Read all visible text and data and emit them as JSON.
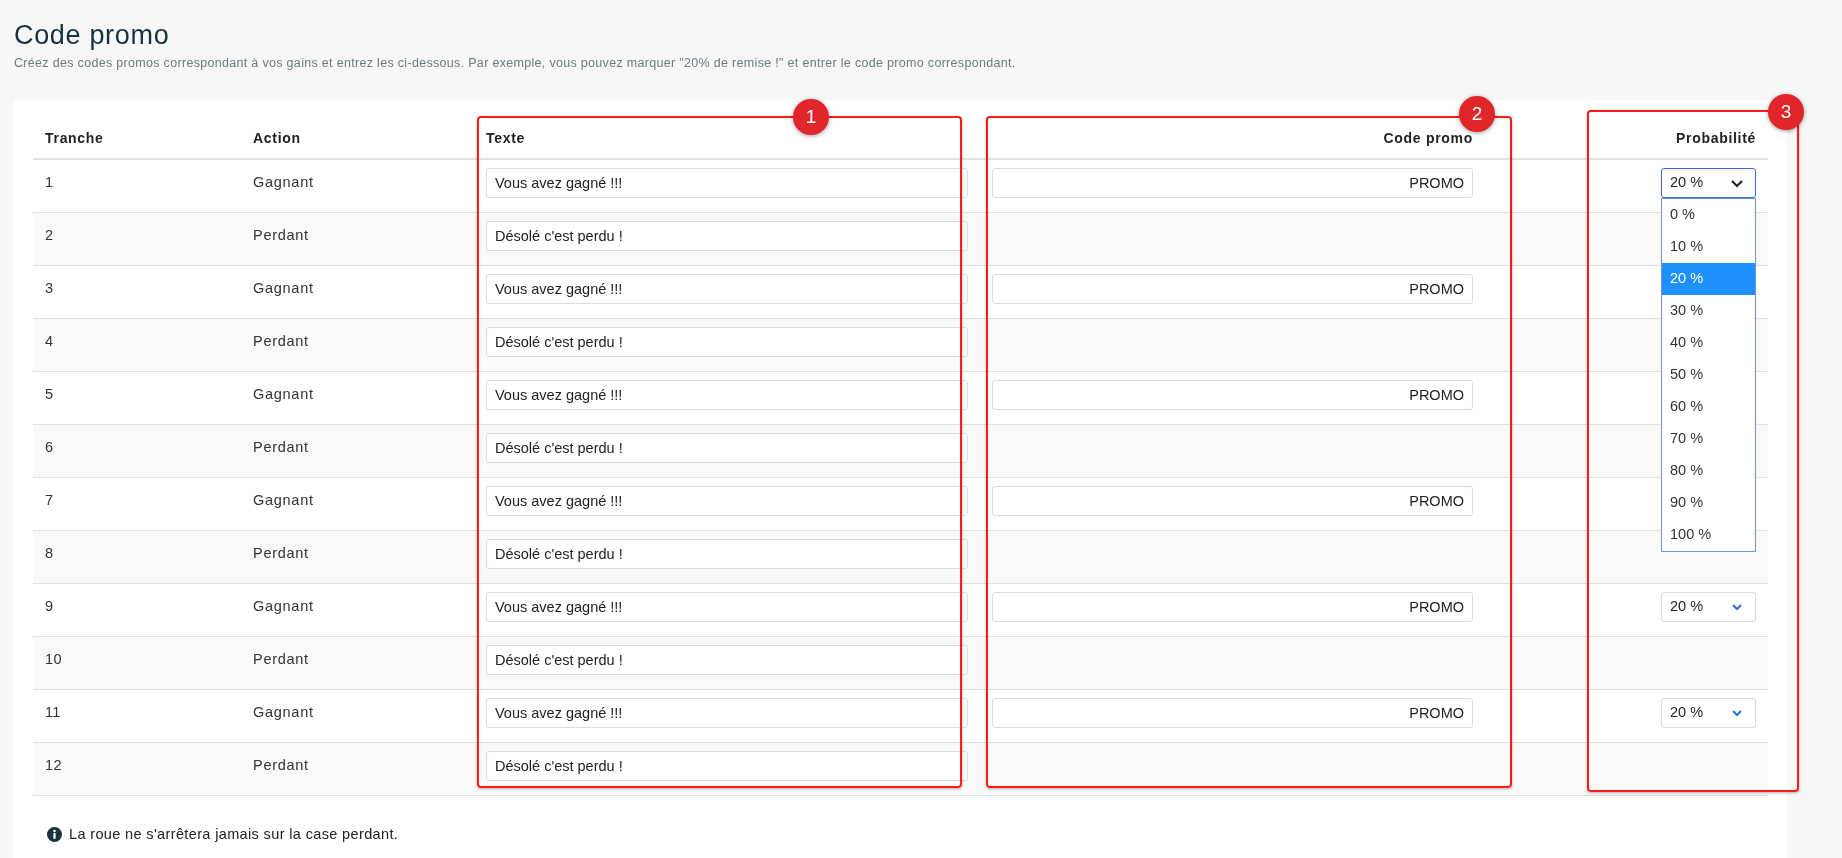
{
  "page": {
    "title": "Code promo",
    "subtitle": "Créez des codes promos correspondant à vos gains et entrez les ci-dessous. Par exemple, vous pouvez marquer \"20% de remise !\" et entrer le code promo correspondant."
  },
  "table": {
    "columns": [
      "Tranche",
      "Action",
      "Texte",
      "Code promo",
      "Probabilité"
    ],
    "rows": [
      {
        "tranche": "1",
        "action": "Gagnant",
        "text": "Vous avez gagné !!!",
        "promo_code": "PROMO",
        "probability": {
          "value": "20 %",
          "open": true,
          "options": [
            {
              "label": "0 %",
              "selected": false
            },
            {
              "label": "10 %",
              "selected": false
            },
            {
              "label": "20 %",
              "selected": true
            },
            {
              "label": "30 %",
              "selected": false
            },
            {
              "label": "40 %",
              "selected": false
            },
            {
              "label": "50 %",
              "selected": false
            },
            {
              "label": "60 %",
              "selected": false
            },
            {
              "label": "70 %",
              "selected": false
            },
            {
              "label": "80 %",
              "selected": false
            },
            {
              "label": "90 %",
              "selected": false
            },
            {
              "label": "100 %",
              "selected": false
            }
          ]
        }
      },
      {
        "tranche": "2",
        "action": "Perdant",
        "text": "Désolé c'est perdu !"
      },
      {
        "tranche": "3",
        "action": "Gagnant",
        "text": "Vous avez gagné !!!",
        "promo_code": "PROMO"
      },
      {
        "tranche": "4",
        "action": "Perdant",
        "text": "Désolé c'est perdu !"
      },
      {
        "tranche": "5",
        "action": "Gagnant",
        "text": "Vous avez gagné !!!",
        "promo_code": "PROMO"
      },
      {
        "tranche": "6",
        "action": "Perdant",
        "text": "Désolé c'est perdu !"
      },
      {
        "tranche": "7",
        "action": "Gagnant",
        "text": "Vous avez gagné !!!",
        "promo_code": "PROMO"
      },
      {
        "tranche": "8",
        "action": "Perdant",
        "text": "Désolé c'est perdu !"
      },
      {
        "tranche": "9",
        "action": "Gagnant",
        "text": "Vous avez gagné !!!",
        "promo_code": "PROMO",
        "probability": {
          "value": "20 %",
          "open": false
        }
      },
      {
        "tranche": "10",
        "action": "Perdant",
        "text": "Désolé c'est perdu !"
      },
      {
        "tranche": "11",
        "action": "Gagnant",
        "text": "Vous avez gagné !!!",
        "promo_code": "PROMO",
        "probability": {
          "value": "20 %",
          "open": false
        }
      },
      {
        "tranche": "12",
        "action": "Perdant",
        "text": "Désolé c'est perdu !"
      }
    ]
  },
  "note": "La roue ne s'arrêtera jamais sur la case perdant.",
  "annotations": [
    {
      "label": "1"
    },
    {
      "label": "2"
    },
    {
      "label": "3"
    }
  ]
}
